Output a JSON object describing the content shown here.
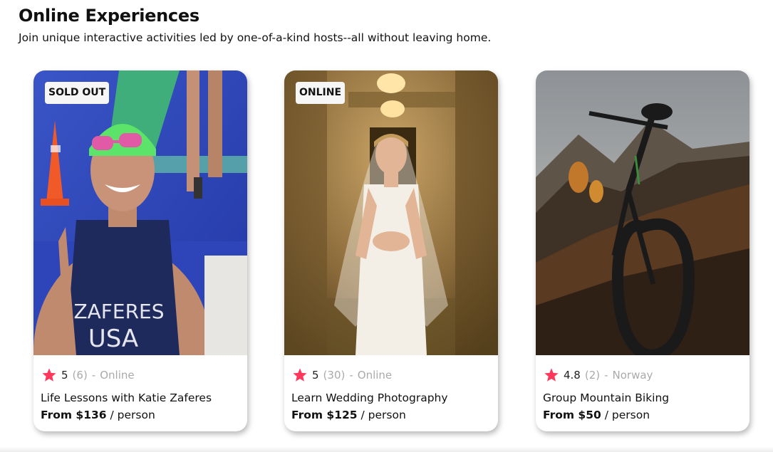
{
  "page": {
    "title": "Online Experiences",
    "subtitle": "Join unique interactive activities led by one-of-a-kind hosts--all without leaving home."
  },
  "colors": {
    "star": "#fe385c",
    "muted": "#aaaaaa",
    "badge_bg": "#f6f6f6"
  },
  "cards": [
    {
      "badge": "SOLD OUT",
      "rating": "5",
      "reviews": "(6)",
      "dash": "-",
      "location": "Online",
      "title": "Life Lessons with Katie Zaferes",
      "price": "From $136",
      "unit": "/ person",
      "image_icon": "swimmer-photo",
      "image_text_1": "ZAFERES",
      "image_text_2": "USA"
    },
    {
      "badge": "ONLINE",
      "rating": "5",
      "reviews": "(30)",
      "dash": "-",
      "location": "Online",
      "title": "Learn Wedding Photography",
      "price": "From $125",
      "unit": "/ person",
      "image_icon": "bride-photo"
    },
    {
      "badge": "",
      "rating": "4.8",
      "reviews": "(2)",
      "dash": "-",
      "location": "Norway",
      "title": "Group Mountain Biking",
      "price": "From $50",
      "unit": "/ person",
      "image_icon": "mountain-bike-photo"
    }
  ]
}
